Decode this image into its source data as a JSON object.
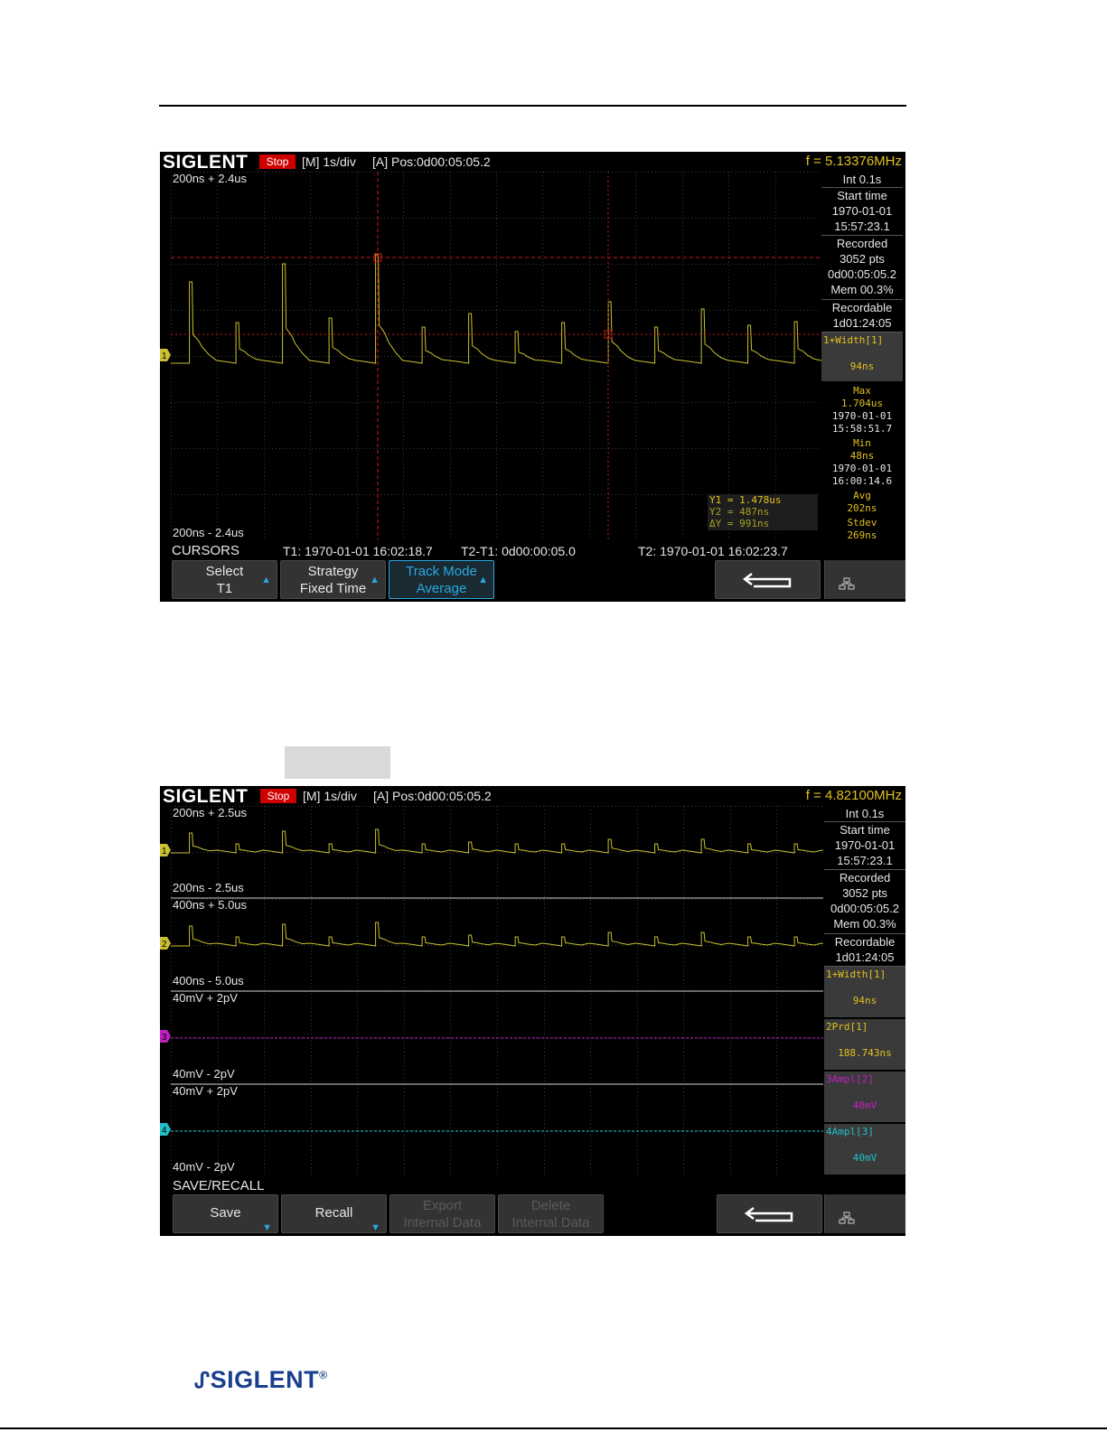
{
  "screen1": {
    "header": {
      "logo": "SIGLENT",
      "status": "Stop",
      "timebase": "[M] 1s/div",
      "position": "[A] Pos:0d00:05:05.2",
      "frequency": "f = 5.13376MHz"
    },
    "scale_top": "200ns + 2.4us",
    "scale_bottom": "200ns - 2.4us",
    "channel_marker": "1",
    "side": {
      "interval": "Int 0.1s",
      "start_label": "Start time",
      "start_date": "1970-01-01",
      "start_time": "15:57:23.1",
      "recorded_label": "Recorded",
      "recorded_pts": "3052 pts",
      "recorded_time": "0d00:05:05.2",
      "mem": "Mem 00.3%",
      "recordable_label": "Recordable",
      "recordable_value": "1d01:24:05",
      "measure_title": "1+Width[1]",
      "measure_value": "94ns",
      "max_label": "Max",
      "max_value": "1.704us",
      "max_date": "1970-01-01",
      "max_time": "15:58:51.7",
      "min_label": "Min",
      "min_value": "48ns",
      "min_date": "1970-01-01",
      "min_time": "16:00:14.6",
      "avg_label": "Avg",
      "avg_value": "202ns",
      "stdev_label": "Stdev",
      "stdev_value": "269ns"
    },
    "cursor_readout": {
      "y1": "Y1 = 1.478us",
      "y2": "Y2 = 487ns",
      "dy": "ΔY = 991ns"
    },
    "status_line": {
      "menu": "CURSORS",
      "t1": "T1: 1970-01-01 16:02:18.7",
      "dt": "T2-T1: 0d00:00:05.0",
      "t2": "T2: 1970-01-01 16:02:23.7"
    },
    "buttons": [
      {
        "line1": "Select",
        "line2": "T1"
      },
      {
        "line1": "Strategy",
        "line2": "Fixed Time"
      },
      {
        "line1": "Track Mode",
        "line2": "Average"
      }
    ],
    "colors": {
      "trace": "#c8c030",
      "cursor": "#d01818"
    }
  },
  "screen2": {
    "header": {
      "logo": "SIGLENT",
      "status": "Stop",
      "timebase": "[M] 1s/div",
      "position": "[A] Pos:0d00:05:05.2",
      "frequency": "f = 4.82100MHz"
    },
    "panels": [
      {
        "top": "200ns + 2.5us",
        "bottom": "200ns - 2.5us",
        "marker": "1"
      },
      {
        "top": "400ns + 5.0us",
        "bottom": "400ns - 5.0us",
        "marker": "2"
      },
      {
        "top": "40mV + 2pV",
        "bottom": "40mV - 2pV",
        "marker": "3"
      },
      {
        "top": "40mV + 2pV",
        "bottom": "40mV - 2pV",
        "marker": "4"
      }
    ],
    "side": {
      "interval": "Int 0.1s",
      "start_label": "Start time",
      "start_date": "1970-01-01",
      "start_time": "15:57:23.1",
      "recorded_label": "Recorded",
      "recorded_pts": "3052 pts",
      "recorded_time": "0d00:05:05.2",
      "mem": "Mem 00.3%",
      "recordable_label": "Recordable",
      "recordable_value": "1d01:24:05",
      "measures": [
        {
          "title": "1+Width[1]",
          "value": "94ns"
        },
        {
          "title": "2Prd[1]",
          "value": "188.743ns"
        },
        {
          "title": "3Ampl[2]",
          "value": "40mV"
        },
        {
          "title": "4Ampl[3]",
          "value": "40mV"
        }
      ]
    },
    "menu": "SAVE/RECALL",
    "buttons": [
      {
        "line1": "Save"
      },
      {
        "line1": "Recall"
      },
      {
        "line1": "Export",
        "line2": "Internal Data"
      },
      {
        "line1": "Delete",
        "line2": "Internal Data"
      }
    ],
    "colors": {
      "ch1": "#c8c030",
      "ch2": "#c8c030",
      "ch3": "#c020c0",
      "ch4": "#20c0c8"
    }
  },
  "footer": {
    "logo": "SIGLENT",
    "registered": "®"
  }
}
